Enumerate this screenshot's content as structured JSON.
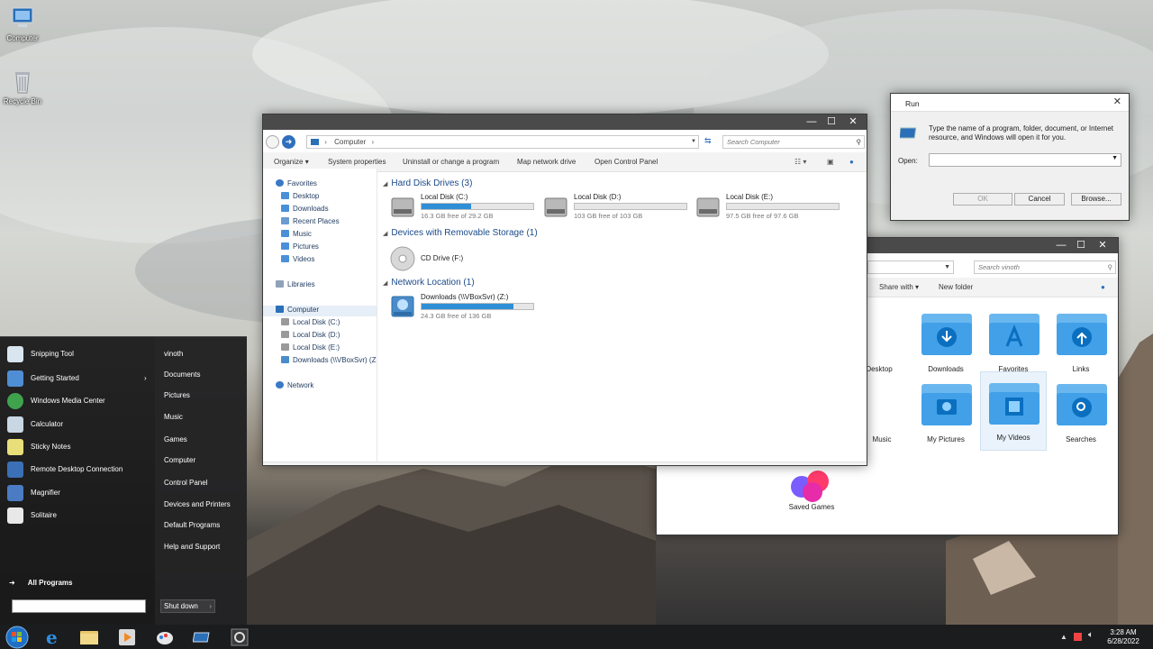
{
  "desktop": {
    "icons": [
      {
        "label": "Computer"
      },
      {
        "label": "Recycle Bin"
      }
    ]
  },
  "explorer": {
    "address": "Computer",
    "search_placeholder": "Search Computer",
    "commands": [
      "Organize",
      "System properties",
      "Uninstall or change a program",
      "Map network drive",
      "Open Control Panel"
    ],
    "nav": {
      "favorites": "Favorites",
      "favorites_items": [
        "Desktop",
        "Downloads",
        "Recent Places",
        "Music",
        "Pictures",
        "Videos"
      ],
      "libraries": "Libraries",
      "computer": "Computer",
      "computer_items": [
        "Local Disk (C:)",
        "Local Disk (D:)",
        "Local Disk (E:)",
        "Downloads (\\\\VBoxSvr) (Z:)"
      ],
      "network": "Network"
    },
    "sections": {
      "hdd": "Hard Disk Drives (3)",
      "removable": "Devices with Removable Storage (1)",
      "network": "Network Location (1)"
    },
    "drives": [
      {
        "name": "Local Disk (C:)",
        "free": "16.3 GB free of 29.2 GB",
        "used_fraction": 0.44
      },
      {
        "name": "Local Disk (D:)",
        "free": "103 GB free of 103 GB",
        "used_fraction": 0.0
      },
      {
        "name": "Local Disk (E:)",
        "free": "97.5 GB free of 97.6 GB",
        "used_fraction": 0.0
      }
    ],
    "cd": {
      "name": "CD Drive (F:)"
    },
    "netdrive": {
      "name": "Downloads (\\\\VBoxSvr) (Z:)",
      "free": "24.3 GB free of 136 GB",
      "used_fraction": 0.82
    }
  },
  "run": {
    "title": "Run",
    "description": "Type the name of a program, folder, document, or Internet resource, and Windows will open it for you.",
    "open_label": "Open:",
    "ok": "OK",
    "cancel": "Cancel",
    "browse": "Browse..."
  },
  "userfolder": {
    "search_placeholder": "Search vinoth",
    "commands": [
      "Share with",
      "New folder"
    ],
    "folders": [
      "Desktop",
      "Downloads",
      "Favorites",
      "Links",
      "Music",
      "My Pictures",
      "My Videos",
      "Searches",
      "Saved Games"
    ]
  },
  "startmenu": {
    "programs": [
      "Snipping Tool",
      "Getting Started",
      "Windows Media Center",
      "Calculator",
      "Sticky Notes",
      "Remote Desktop Connection",
      "Magnifier",
      "Solitaire"
    ],
    "right": [
      "vinoth",
      "Documents",
      "Pictures",
      "Music",
      "Games",
      "Computer",
      "Control Panel",
      "Devices and Printers",
      "Default Programs",
      "Help and Support"
    ],
    "all_programs": "All Programs",
    "shutdown": "Shut down"
  },
  "taskbar": {
    "time": "3:28 AM",
    "date": "6/28/2022"
  },
  "colors": {
    "accent": "#2f8fd6",
    "titlebar": "#4a4a4a",
    "taskbar": "#1b1c1e"
  }
}
